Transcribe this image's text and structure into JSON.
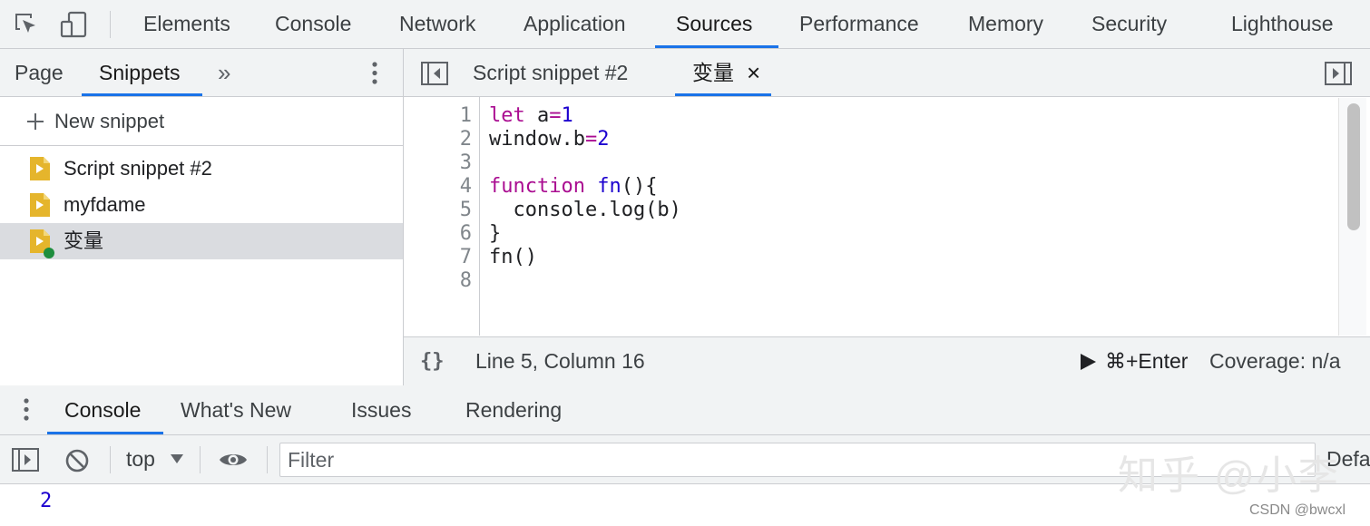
{
  "topbar": {
    "tabs": [
      "Elements",
      "Console",
      "Network",
      "Application",
      "Sources",
      "Performance",
      "Memory",
      "Security",
      "Lighthouse"
    ],
    "active_tab": "Sources"
  },
  "navigator": {
    "tabs": [
      "Page",
      "Snippets"
    ],
    "active_tab": "Snippets",
    "more_label": "»",
    "new_snippet_label": "New snippet",
    "snippets": [
      "Script snippet #2",
      "myfdame",
      "变量"
    ],
    "selected_snippet": "变量"
  },
  "editor": {
    "tabs": [
      "Script snippet #2",
      "变量"
    ],
    "active_tab": "变量",
    "close_glyph": "×",
    "line_numbers": [
      "1",
      "2",
      "3",
      "4",
      "5",
      "6",
      "7",
      "8"
    ],
    "code_lines": [
      "let a=1",
      "window.b=2",
      "",
      "function fn(){",
      "  console.log(b)",
      "}",
      "fn()",
      ""
    ]
  },
  "statusbar": {
    "format_glyph": "{}",
    "position": "Line 5, Column 16",
    "run_label": "⌘+Enter",
    "coverage": "Coverage: n/a"
  },
  "drawer": {
    "tabs": [
      "Console",
      "What's New",
      "Issues",
      "Rendering"
    ],
    "active_tab": "Console"
  },
  "console_toolbar": {
    "context": "top",
    "filter_placeholder": "Filter",
    "levels_label": "Defa"
  },
  "console_output": [
    "2"
  ],
  "watermarks": {
    "zhihu": "知乎 @小李",
    "csdn": "CSDN @bwcxl"
  },
  "colors": {
    "accent": "#1a73e8",
    "snippet_icon": "#e5b52c",
    "running_dot": "#1e8e3e",
    "selected_row": "#dadce0",
    "keyword": "#aa0d91",
    "number": "#1c00cf"
  }
}
